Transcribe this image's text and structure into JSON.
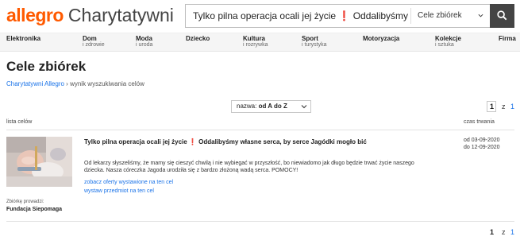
{
  "header": {
    "logo_brand": "allegro",
    "logo_sub": "Charytatywni",
    "search_value": "Tylko pilna operacja ocali jej życie ❗ Oddalibyśmy własne ser",
    "search_category": "Cele zbiórek",
    "search_button_icon": "magnifier-icon"
  },
  "nav": [
    {
      "main": "Elektronika",
      "second": ""
    },
    {
      "main": "Dom",
      "second": "i zdrowie"
    },
    {
      "main": "Moda",
      "second": "i uroda"
    },
    {
      "main": "Dziecko",
      "second": ""
    },
    {
      "main": "Kultura",
      "second": "i rozrywka"
    },
    {
      "main": "Sport",
      "second": "i turystyka"
    },
    {
      "main": "Motoryzacja",
      "second": ""
    },
    {
      "main": "Kolekcje",
      "second": "i sztuka"
    },
    {
      "main": "Firma",
      "second": ""
    }
  ],
  "page_title": "Cele zbiórek",
  "breadcrumb": {
    "link": "Charytatywni Allegro",
    "sep": "›",
    "current": "wynik wyszukiwania celów"
  },
  "sort": {
    "label": "nazwa:",
    "value": "od A do Z"
  },
  "pager": {
    "current": "1",
    "of": "z",
    "total": "1"
  },
  "table": {
    "col_left": "lista celów",
    "col_right": "czas trwania"
  },
  "result": {
    "title_before": "Tylko pilna operacja ocali jej życie",
    "title_mark": "❗",
    "title_after": "Oddalibyśmy własne serca, by serce Jagódki mogło bić",
    "description": "Od lekarzy słyszeliśmy, że mamy się cieszyć chwilą i nie wybiegać w przyszłość, bo niewiadomo jak długo będzie trwać życie naszego dziecka. Nasza córeczka Jagoda urodziła się z bardzo złożoną wadą serca. POMOCY!",
    "link_offers": "zobacz oferty wystawione na ten cel",
    "link_list": "wystaw przedmiot na ten cel",
    "date_from": "od 03-09-2020",
    "date_to": "do 12-09-2020",
    "org_label": "Zbiórkę prowadzi:",
    "org_name": "Fundacja Siepomaga"
  },
  "colors": {
    "brand": "#ff5a00",
    "link": "#1a73e8",
    "search_button": "#444444"
  }
}
